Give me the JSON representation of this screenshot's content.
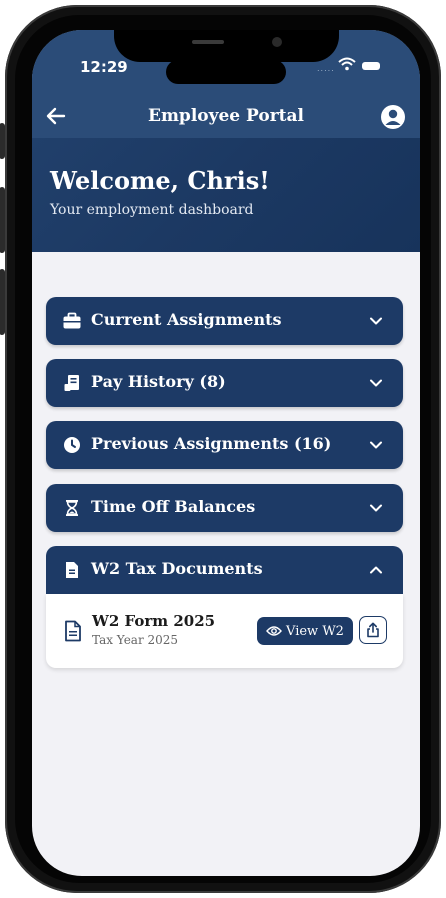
{
  "status_bar": {
    "time": "12:29",
    "signal": "....."
  },
  "nav": {
    "title": "Employee Portal"
  },
  "hero": {
    "title": "Welcome, Chris!",
    "subtitle": "Your employment dashboard"
  },
  "sections": [
    {
      "label": "Current Assignments",
      "icon": "briefcase-icon",
      "expanded": false
    },
    {
      "label": "Pay History (8)",
      "icon": "receipt-icon",
      "expanded": false
    },
    {
      "label": "Previous Assignments (16)",
      "icon": "clock-icon",
      "expanded": false
    },
    {
      "label": "Time Off Balances",
      "icon": "hourglass-icon",
      "expanded": false
    },
    {
      "label": "W2 Tax Documents",
      "icon": "document-icon",
      "expanded": true
    }
  ],
  "documents": [
    {
      "name": "W2 Form 2025",
      "year": "Tax Year 2025",
      "view_label": "View W2"
    }
  ],
  "colors": {
    "primary": "#1d3a66",
    "header": "#2b4c78",
    "background": "#f2f2f6"
  }
}
